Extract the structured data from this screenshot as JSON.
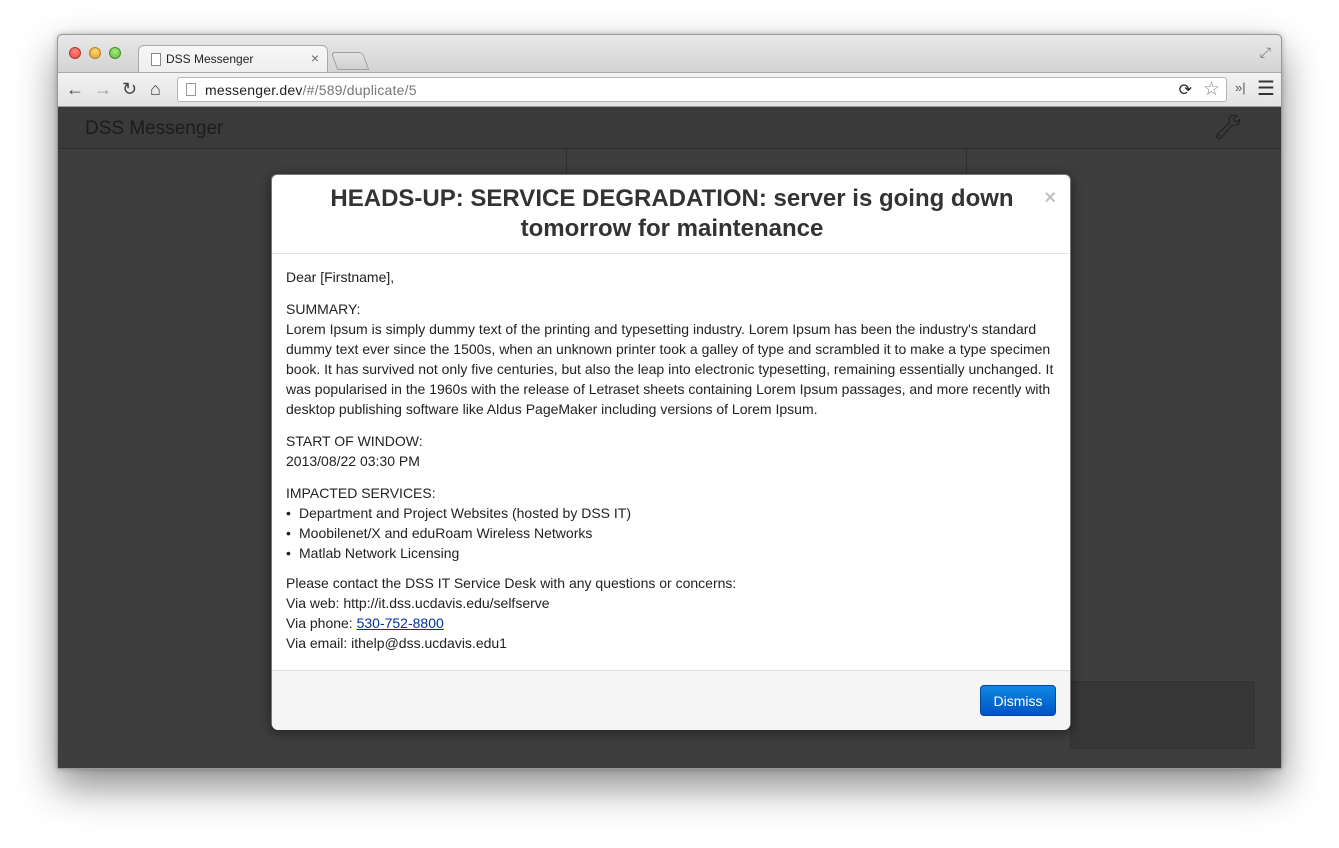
{
  "browser": {
    "tab_title": "DSS Messenger",
    "tab_close": "×",
    "url_host": "messenger.dev",
    "url_path": "/#/589/duplicate/5",
    "overflow": "»|",
    "menu": "☰"
  },
  "app": {
    "brand": "DSS Messenger"
  },
  "modal": {
    "title": "HEADS-UP: SERVICE DEGRADATION: server is going down tomorrow for maintenance",
    "close": "×",
    "greeting": "Dear [Firstname],",
    "summary_label": "SUMMARY:",
    "summary_text": "Lorem Ipsum is simply dummy text of the printing and typesetting industry. Lorem Ipsum has been the industry's standard dummy text ever since the 1500s, when an unknown printer took a galley of type and scrambled it to make a type specimen book. It has survived not only five centuries, but also the leap into electronic typesetting, remaining essentially unchanged. It was popularised in the 1960s with the release of Letraset sheets containing Lorem Ipsum passages, and more recently with desktop publishing software like Aldus PageMaker including versions of Lorem Ipsum.",
    "start_label": "START OF WINDOW:",
    "start_value": "2013/08/22 03:30 PM",
    "impacted_label": "IMPACTED SERVICES:",
    "impacted_services": [
      "Department and Project Websites (hosted by DSS IT)",
      "Moobilenet/X and eduRoam Wireless Networks",
      "Matlab Network Licensing"
    ],
    "contact_intro": "Please contact the DSS IT Service Desk with any questions or concerns:",
    "via_web_label": "Via web:",
    "via_web_value": "http://it.dss.ucdavis.edu/selfserve",
    "via_phone_label": "Via phone:",
    "via_phone_value": "530-752-8800",
    "via_email_label": "Via email:",
    "via_email_value": "ithelp@dss.ucdavis.edu1",
    "dismiss_label": "Dismiss"
  },
  "colors": {
    "accent": "#0a6fd8",
    "link": "#00329a",
    "backdrop": "#3e3e3e"
  },
  "icons": [
    "page-icon",
    "back-icon",
    "forward-icon",
    "reload-icon",
    "home-icon",
    "star-icon",
    "menu-icon",
    "wrench-icon",
    "close-icon",
    "fullscreen-icon"
  ]
}
